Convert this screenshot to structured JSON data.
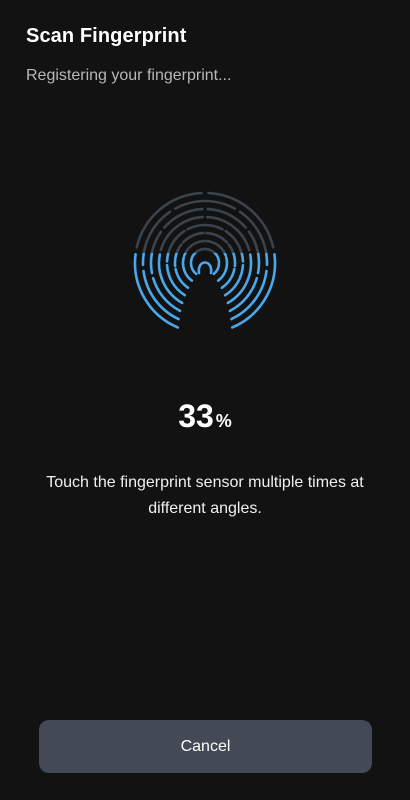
{
  "header": {
    "title": "Scan Fingerprint",
    "subtitle": "Registering your fingerprint..."
  },
  "scan": {
    "icon": "fingerprint-icon",
    "progress_percent": 33,
    "progress_value": "33",
    "progress_unit": "%",
    "instruction": "Touch the fingerprint sensor multiple times at different angles."
  },
  "footer": {
    "cancel_label": "Cancel"
  },
  "colors": {
    "background": "#121212",
    "ridge_inactive": "#3c434d",
    "ridge_active": "#4aa8ea",
    "button_bg": "#434a56"
  }
}
